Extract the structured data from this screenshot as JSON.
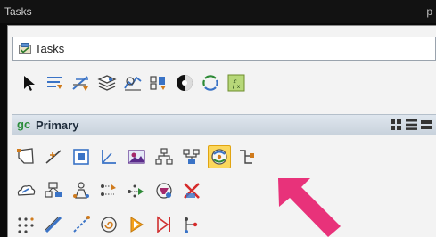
{
  "window": {
    "title": "Tasks",
    "pin_glyph": "ᵽ"
  },
  "task_selector": {
    "value": "Tasks",
    "icon": "tasks-folder-icon"
  },
  "general_tools": [
    "element-selection-icon",
    "attributes-icon",
    "measure-icon",
    "levels-icon",
    "analyze-icon",
    "models-icon",
    "render-icon",
    "refresh-icon",
    "function-icon"
  ],
  "primary": {
    "logo": "gc",
    "title": "Primary",
    "view_modes": [
      "grid-view-icon",
      "list-view-icon",
      "detail-view-icon"
    ],
    "rows": [
      [
        "polygon-icon",
        "line-icon",
        "square-icon",
        "angle-icon",
        "image-icon",
        "hierarchy-icon",
        "network-icon",
        "highlighted-tool-icon",
        "branch-icon"
      ],
      [
        "cloud-edit-icon",
        "group-icon",
        "people-icon",
        "transform-icon",
        "move-points-icon",
        "layers-icon",
        "delete-icon"
      ],
      [
        "dots-grid-icon",
        "diagonal-line-icon",
        "dashed-line-icon",
        "spiral-icon",
        "play-icon",
        "step-end-icon",
        "trace-icon"
      ]
    ],
    "highlighted_index": 7
  },
  "colors": {
    "highlight_fill": "#fbd75c",
    "highlight_border": "#e1a412",
    "annotation_arrow": "#e8327a",
    "header_text": "#1d2b3a",
    "logo_green": "#2c8d3c"
  }
}
